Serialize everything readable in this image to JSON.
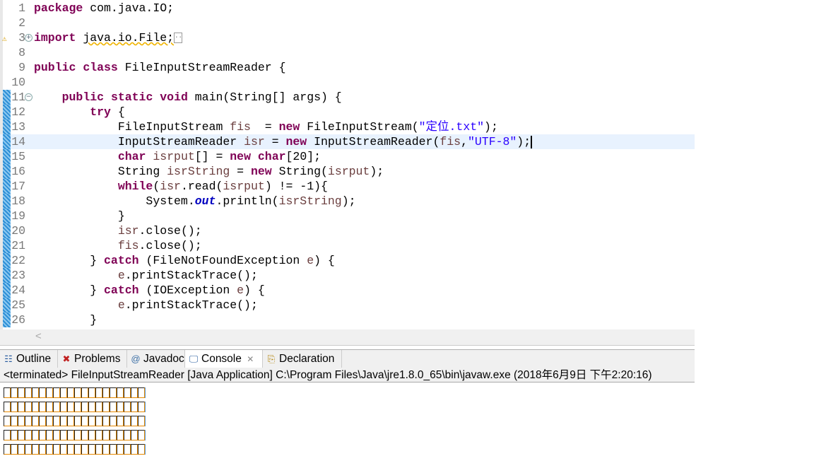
{
  "editor": {
    "current_line": 14,
    "lines": [
      {
        "n": "1",
        "tokens": [
          [
            "package",
            "kw"
          ],
          [
            " com.java.IO;",
            ""
          ]
        ]
      },
      {
        "n": "2",
        "tokens": []
      },
      {
        "n": "3",
        "tokens": [
          [
            "import",
            "kw"
          ],
          [
            " ",
            ""
          ],
          [
            "java.io.File;",
            "warn"
          ]
        ],
        "collapsed": true,
        "warning": true,
        "fold": "plus"
      },
      {
        "n": "8",
        "tokens": []
      },
      {
        "n": "9",
        "tokens": [
          [
            "public",
            "kw"
          ],
          [
            " ",
            ""
          ],
          [
            "class",
            "kw"
          ],
          [
            " FileInputStreamReader {",
            ""
          ]
        ]
      },
      {
        "n": "10",
        "tokens": []
      },
      {
        "n": "11",
        "tokens": [
          [
            "    ",
            ""
          ],
          [
            "public",
            "kw"
          ],
          [
            " ",
            ""
          ],
          [
            "static",
            "kw"
          ],
          [
            " ",
            ""
          ],
          [
            "void",
            "kw"
          ],
          [
            " main(String[] args) {",
            ""
          ]
        ],
        "fold": "minus",
        "changed": true
      },
      {
        "n": "12",
        "tokens": [
          [
            "        ",
            ""
          ],
          [
            "try",
            "kw"
          ],
          [
            " {",
            ""
          ]
        ],
        "changed": true
      },
      {
        "n": "13",
        "tokens": [
          [
            "            FileInputStream ",
            ""
          ],
          [
            "fis",
            "var"
          ],
          [
            "  = ",
            ""
          ],
          [
            "new",
            "kw"
          ],
          [
            " FileInputStream(",
            ""
          ],
          [
            "\"定位.txt\"",
            "str"
          ],
          [
            ");",
            ""
          ]
        ],
        "changed": true
      },
      {
        "n": "14",
        "tokens": [
          [
            "            InputStreamReader ",
            ""
          ],
          [
            "isr",
            "var"
          ],
          [
            " = ",
            ""
          ],
          [
            "new",
            "kw"
          ],
          [
            " InputStreamReader(",
            ""
          ],
          [
            "fis",
            "var"
          ],
          [
            ",",
            ""
          ],
          [
            "\"UTF-8\"",
            "str"
          ],
          [
            ");",
            ""
          ]
        ],
        "changed": true,
        "caret": true
      },
      {
        "n": "15",
        "tokens": [
          [
            "            ",
            ""
          ],
          [
            "char",
            "kw"
          ],
          [
            " ",
            ""
          ],
          [
            "isrput",
            "var"
          ],
          [
            "[] = ",
            ""
          ],
          [
            "new",
            "kw"
          ],
          [
            " ",
            ""
          ],
          [
            "char",
            "kw"
          ],
          [
            "[20];",
            ""
          ]
        ],
        "changed": true
      },
      {
        "n": "16",
        "tokens": [
          [
            "            String ",
            ""
          ],
          [
            "isrString",
            "var"
          ],
          [
            " = ",
            ""
          ],
          [
            "new",
            "kw"
          ],
          [
            " String(",
            ""
          ],
          [
            "isrput",
            "var"
          ],
          [
            ");",
            ""
          ]
        ],
        "changed": true
      },
      {
        "n": "17",
        "tokens": [
          [
            "            ",
            ""
          ],
          [
            "while",
            "kw"
          ],
          [
            "(",
            ""
          ],
          [
            "isr",
            "var"
          ],
          [
            ".read(",
            ""
          ],
          [
            "isrput",
            "var"
          ],
          [
            ") != -1){",
            ""
          ]
        ],
        "changed": true
      },
      {
        "n": "18",
        "tokens": [
          [
            "                System.",
            ""
          ],
          [
            "out",
            "fld"
          ],
          [
            ".println(",
            ""
          ],
          [
            "isrString",
            "var"
          ],
          [
            ");",
            ""
          ]
        ],
        "changed": true
      },
      {
        "n": "19",
        "tokens": [
          [
            "            }",
            ""
          ]
        ],
        "changed": true
      },
      {
        "n": "20",
        "tokens": [
          [
            "            ",
            ""
          ],
          [
            "isr",
            "var"
          ],
          [
            ".close();",
            ""
          ]
        ],
        "changed": true
      },
      {
        "n": "21",
        "tokens": [
          [
            "            ",
            ""
          ],
          [
            "fis",
            "var"
          ],
          [
            ".close();",
            ""
          ]
        ],
        "changed": true
      },
      {
        "n": "22",
        "tokens": [
          [
            "        } ",
            ""
          ],
          [
            "catch",
            "kw"
          ],
          [
            " (FileNotFoundException ",
            ""
          ],
          [
            "e",
            "var"
          ],
          [
            ") {",
            ""
          ]
        ],
        "changed": true
      },
      {
        "n": "23",
        "tokens": [
          [
            "            ",
            ""
          ],
          [
            "e",
            "var"
          ],
          [
            ".printStackTrace();",
            ""
          ]
        ],
        "changed": true
      },
      {
        "n": "24",
        "tokens": [
          [
            "        } ",
            ""
          ],
          [
            "catch",
            "kw"
          ],
          [
            " (IOException ",
            ""
          ],
          [
            "e",
            "var"
          ],
          [
            ") {",
            ""
          ]
        ],
        "changed": true
      },
      {
        "n": "25",
        "tokens": [
          [
            "            ",
            ""
          ],
          [
            "e",
            "var"
          ],
          [
            ".printStackTrace();",
            ""
          ]
        ],
        "changed": true
      },
      {
        "n": "26",
        "tokens": [
          [
            "        }",
            ""
          ]
        ],
        "changed": true
      }
    ]
  },
  "views": {
    "tabs": [
      {
        "label": "Outline",
        "icon": "outline-icon"
      },
      {
        "label": "Problems",
        "icon": "problems-icon"
      },
      {
        "label": "Javadoc",
        "icon": "javadoc-icon"
      },
      {
        "label": "Console",
        "icon": "console-icon",
        "active": true
      },
      {
        "label": "Declaration",
        "icon": "declaration-icon"
      }
    ],
    "close_glyph": "✕"
  },
  "console": {
    "header": "<terminated> FileInputStreamReader [Java Application] C:\\Program Files\\Java\\jre1.8.0_65\\bin\\javaw.exe (2018年6月9日 下午2:20:16)",
    "output_lines": [
      20,
      20,
      20,
      20,
      20
    ]
  }
}
